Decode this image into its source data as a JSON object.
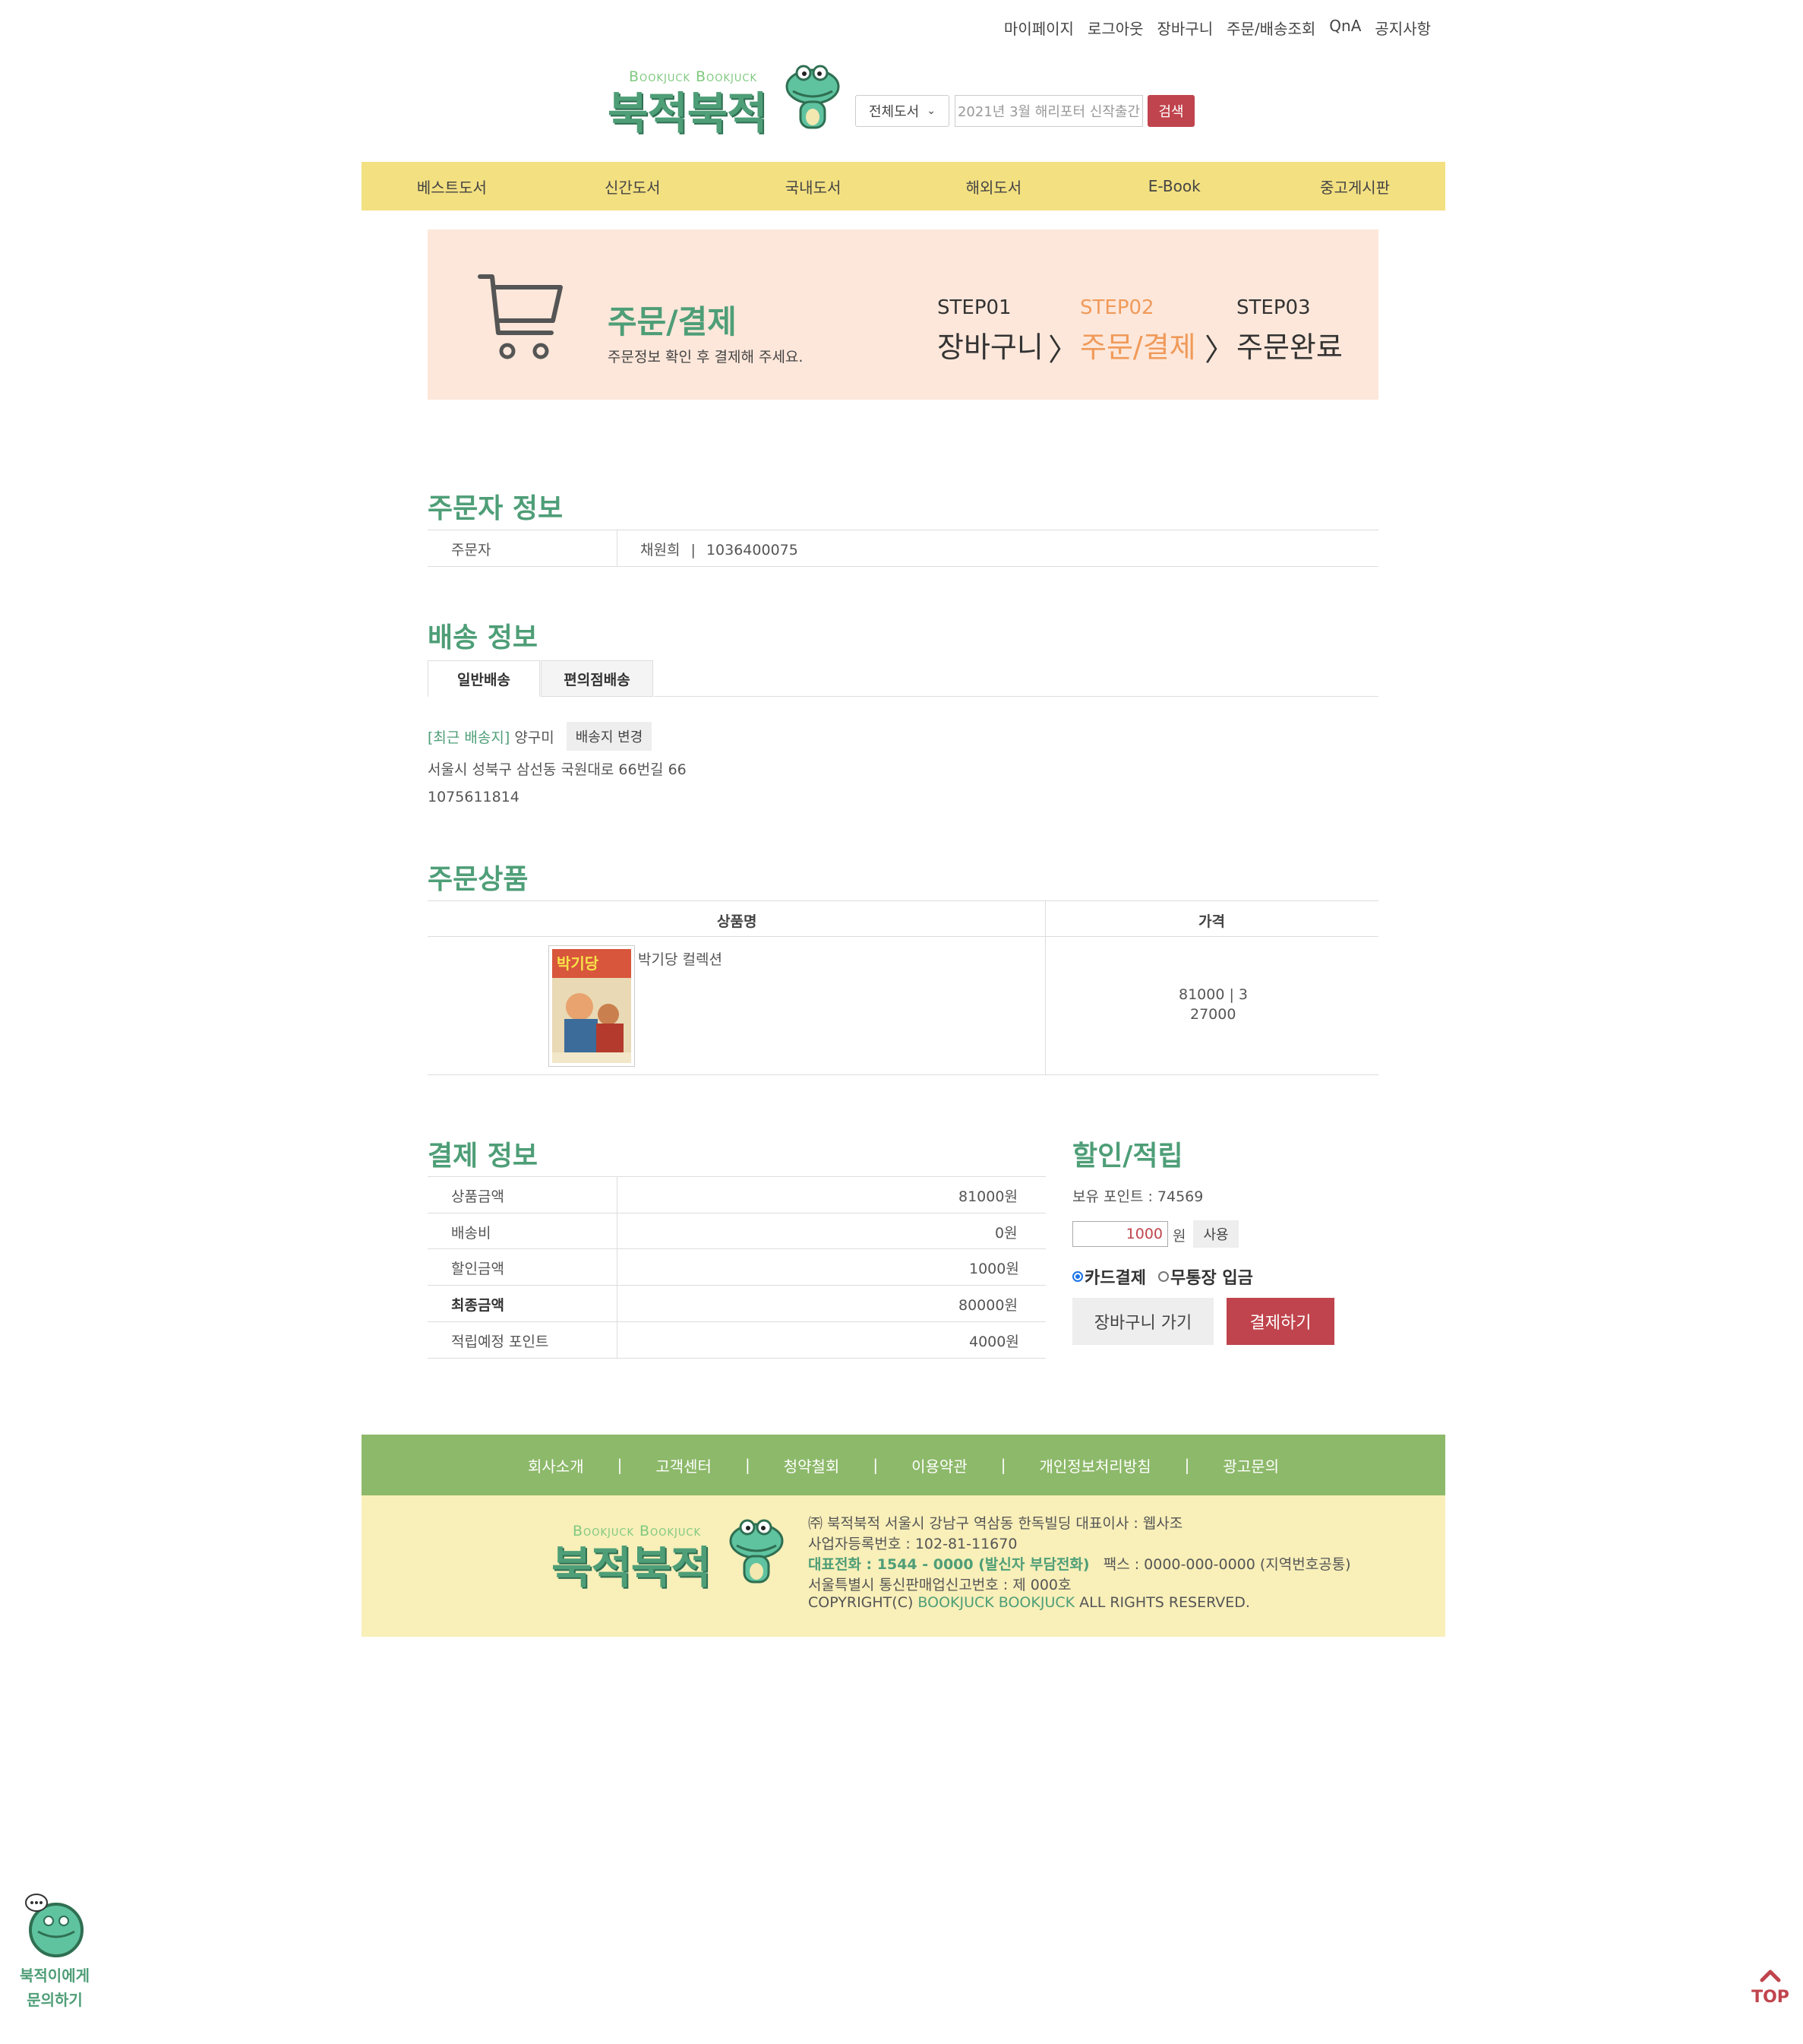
{
  "topnav": [
    "마이페이지",
    "로그아웃",
    "장바구니",
    "주문/배송조회",
    "QnA",
    "공지사항"
  ],
  "logo": {
    "en": "Bookjuck Bookjuck",
    "ko": "북적북적"
  },
  "search": {
    "category": "전체도서",
    "placeholder": "2021년 3월 해리포터 신작출간",
    "button": "검색"
  },
  "mainnav": [
    "베스트도서",
    "신간도서",
    "국내도서",
    "해외도서",
    "E-Book",
    "중고게시판"
  ],
  "banner": {
    "title": "주문/결제",
    "subtitle": "주문정보 확인 후 결제해 주세요.",
    "steps": [
      {
        "label": "STEP01",
        "name": "장바구니"
      },
      {
        "label": "STEP02",
        "name": "주문/결제"
      },
      {
        "label": "STEP03",
        "name": "주문완료"
      }
    ]
  },
  "orderer": {
    "title": "주문자 정보",
    "label": "주문자",
    "name": "채원희",
    "sep": "|",
    "phone": "1036400075"
  },
  "shipping": {
    "title": "배송 정보",
    "tabs": [
      "일반배송",
      "편의점배송"
    ],
    "recent_label": "[최근 배송지]",
    "recent_name": "양구미",
    "change_button": "배송지 변경",
    "address": "서울시 성북구 삼선동 국원대로 66번길 66",
    "phone": "1075611814"
  },
  "products": {
    "title": "주문상품",
    "headers": [
      "상품명",
      "가격"
    ],
    "items": [
      {
        "name": "박기당 컬렉션",
        "price_line": "81000 | 3",
        "unit_line": "27000"
      }
    ]
  },
  "payment": {
    "title": "결제 정보",
    "rows": [
      {
        "label": "상품금액",
        "value": "81000원"
      },
      {
        "label": "배송비",
        "value": "0원"
      },
      {
        "label": "할인금액",
        "value": "1000원"
      },
      {
        "label": "최종금액",
        "value": "80000원"
      },
      {
        "label": "적립예정 포인트",
        "value": "4000원"
      }
    ]
  },
  "discount": {
    "title": "할인/적립",
    "points_label": "보유 포인트 : 74569",
    "point_input": "1000",
    "won": "원",
    "use_button": "사용",
    "method_card": "카드결제",
    "method_bank": "무통장 입금",
    "cart_button": "장바구니 가기",
    "pay_button": "결제하기"
  },
  "footer": {
    "links": [
      "회사소개",
      "|",
      "고객센터",
      "|",
      "청약철회",
      "|",
      "이용약관",
      "|",
      "개인정보처리방침",
      "|",
      "광고문의"
    ],
    "line1": "㈜ 북적북적   서울시 강남구 역삼동 한독빌딩   대표이사 : 웹사조",
    "line2": "사업자등록번호 : 102-81-11670",
    "line3_green": "대표전화 : 1544 - 0000 (발신자 부담전화)",
    "line3_rest": "   팩스 : 0000-000-0000 (지역번호공통)",
    "line4": "서울특별시 통신판매업신고번호 : 제 000호",
    "line5_a": "COPYRIGHT(C) ",
    "line5_green": "BOOKJUCK BOOKJUCK",
    "line5_b": " ALL RIGHTS RESERVED."
  },
  "chatbot": {
    "line1": "북적이에게",
    "line2": "문의하기"
  },
  "top_button": "TOP",
  "colors": {
    "green": "#4e9e77",
    "red": "#c0444d",
    "yellow": "#f3e081",
    "peach": "#fde7da",
    "footer_green": "#8db96a"
  }
}
